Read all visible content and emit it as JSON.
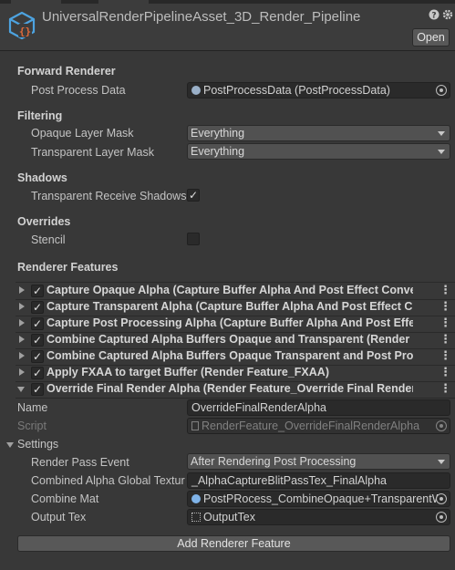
{
  "header": {
    "title": "UniversalRenderPipelineAsset_3D_Render_Pipeline",
    "help_icon": "help-icon",
    "settings_icon": "settings-icon",
    "open_label": "Open"
  },
  "forward_renderer": {
    "heading": "Forward Renderer",
    "post_process_label": "Post Process Data",
    "post_process_value": "PostProcessData (PostProcessData)"
  },
  "filtering": {
    "heading": "Filtering",
    "opaque_label": "Opaque Layer Mask",
    "opaque_value": "Everything",
    "transparent_label": "Transparent Layer Mask",
    "transparent_value": "Everything"
  },
  "shadows": {
    "heading": "Shadows",
    "transparent_receive_label": "Transparent Receive Shadows",
    "transparent_receive_checked": true
  },
  "overrides": {
    "heading": "Overrides",
    "stencil_label": "Stencil",
    "stencil_checked": false
  },
  "renderer_features": {
    "heading": "Renderer Features",
    "items": [
      {
        "label": "Capture Opaque Alpha (Capture Buffer Alpha And Post Effect Conve",
        "enabled": true,
        "expanded": false
      },
      {
        "label": "Capture Transparent Alpha (Capture Buffer Alpha And Post Effect C",
        "enabled": true,
        "expanded": false
      },
      {
        "label": "Capture Post Processing Alpha (Capture Buffer Alpha And Post Effe",
        "enabled": true,
        "expanded": false
      },
      {
        "label": "Combine Captured Alpha Buffers Opaque and Transparent (Render F",
        "enabled": true,
        "expanded": false
      },
      {
        "label": "Combine Captured Alpha Buffers Opaque Transparent and Post Proc",
        "enabled": true,
        "expanded": false
      },
      {
        "label": "Apply FXAA to target Buffer (Render Feature_FXAA)",
        "enabled": true,
        "expanded": false
      },
      {
        "label": "Override Final Render Alpha (Render Feature_Override Final Render A",
        "enabled": true,
        "expanded": true
      }
    ],
    "expanded_feature": {
      "name_label": "Name",
      "name_value": "OverrideFinalRenderAlpha",
      "script_label": "Script",
      "script_value": "RenderFeature_OverrideFinalRenderAlpha",
      "settings_label": "Settings",
      "render_pass_event_label": "Render Pass Event",
      "render_pass_event_value": "After Rendering Post Processing",
      "combined_alpha_label": "Combined Alpha Global Textur",
      "combined_alpha_value": "_AlphaCaptureBlitPassTex_FinalAlpha",
      "combine_mat_label": "Combine Mat",
      "combine_mat_value": "PostPRocess_CombineOpaque+TransparentW",
      "output_tex_label": "Output Tex",
      "output_tex_value": "OutputTex"
    },
    "add_button_label": "Add Renderer Feature"
  },
  "colors": {
    "background": "#383838",
    "header": "#3c3c3c",
    "field": "#2a2a2a",
    "dropdown": "#515151",
    "button": "#585858",
    "asset_icon_accent": "#4da3e0",
    "asset_icon_secondary": "#e06a3a"
  }
}
